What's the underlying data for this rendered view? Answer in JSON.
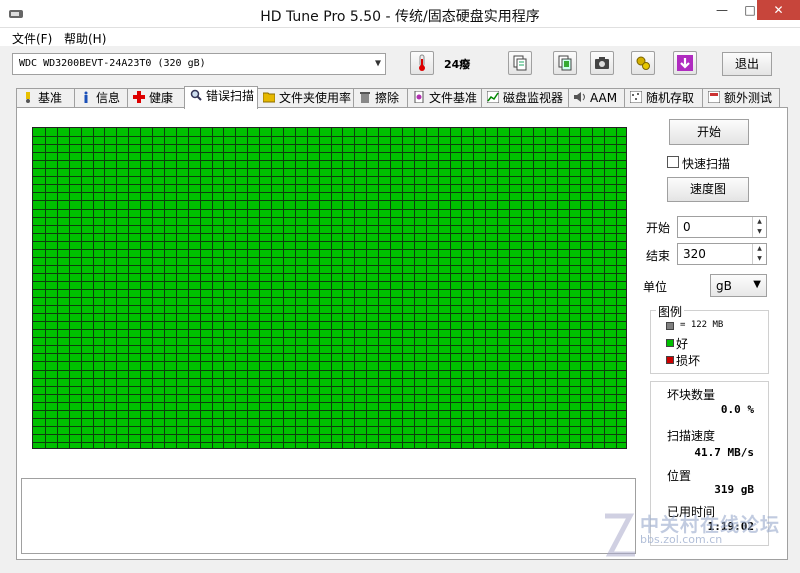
{
  "window": {
    "title": "HD Tune Pro 5.50 - 传统/固态硬盘实用程序",
    "minimize": "—",
    "maximize": "□",
    "close": "✕"
  },
  "menu": [
    {
      "label": "文件(F)"
    },
    {
      "label": "帮助(H)"
    }
  ],
  "toolbar": {
    "drive": "WDC WD3200BEVT-24A23T0 (320 gB)",
    "temperature": "24癈",
    "exit_label": "退出",
    "icons": [
      "thermometer-icon",
      "copy-info-icon",
      "copy-screen-icon",
      "camera-icon",
      "options-icon",
      "save-icon"
    ]
  },
  "tabs": [
    {
      "label": "基准",
      "icon": "benchmark-icon"
    },
    {
      "label": "信息",
      "icon": "info-icon"
    },
    {
      "label": "健康",
      "icon": "health-icon"
    },
    {
      "label": "错误扫描",
      "icon": "magnifier-icon",
      "active": true
    },
    {
      "label": "文件夹使用率",
      "icon": "folder-icon"
    },
    {
      "label": "擦除",
      "icon": "erase-icon"
    },
    {
      "label": "文件基准",
      "icon": "file-benchmark-icon"
    },
    {
      "label": "磁盘监视器",
      "icon": "disk-monitor-icon"
    },
    {
      "label": "AAM",
      "icon": "speaker-icon"
    },
    {
      "label": "随机存取",
      "icon": "random-access-icon"
    },
    {
      "label": "额外测试",
      "icon": "extra-tests-icon"
    }
  ],
  "scan": {
    "start_label": "开始",
    "quick_scan_label": "快速扫描",
    "quick_scan_checked": false,
    "speed_map_label": "速度图",
    "start_field_label": "开始",
    "start_value": "0",
    "end_field_label": "结束",
    "end_value": "320",
    "unit_label": "单位",
    "unit_value": "gB",
    "grid_status": "good",
    "grid_color": "#00c000",
    "bad_color": "#cc0000",
    "block_color": "#808080"
  },
  "legend": {
    "title": "图例",
    "block_size": "= 122 MB",
    "good": "好",
    "bad": "损坏"
  },
  "stats": {
    "bad_blocks_label": "坏块数量",
    "bad_blocks_value": "0.0 %",
    "scan_speed_label": "扫描速度",
    "scan_speed_value": "41.7 MB/s",
    "position_label": "位置",
    "position_value": "319 gB",
    "elapsed_label": "已用时间",
    "elapsed_value": "1:19:02"
  },
  "watermark": {
    "text": "中关村在线论坛",
    "url": "bbs.zol.com.cn"
  }
}
